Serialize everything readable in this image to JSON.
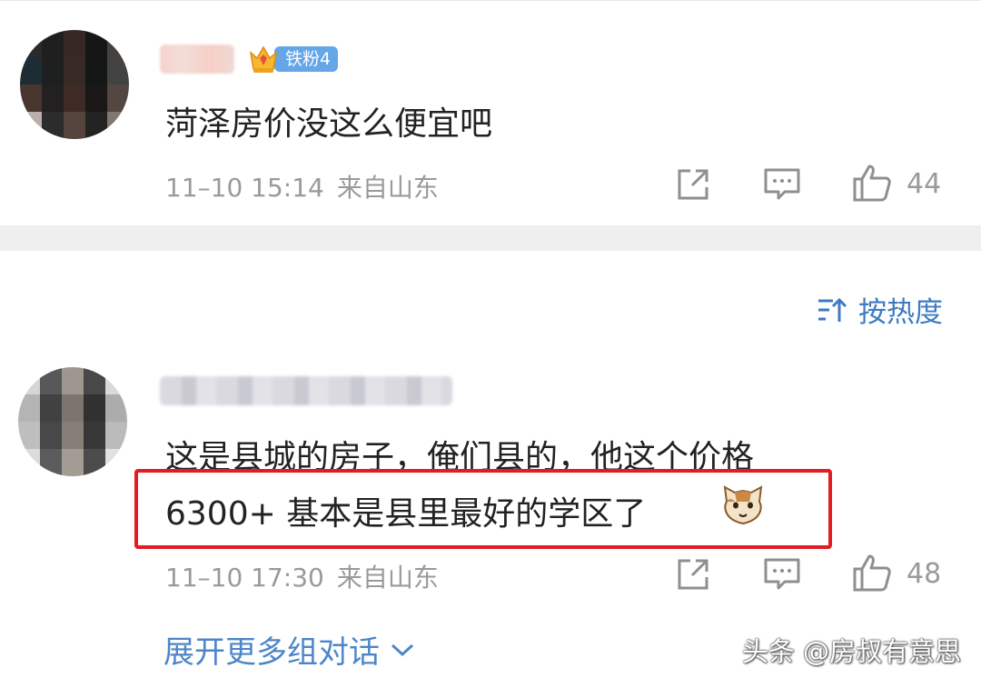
{
  "comment1": {
    "badge": "铁粉4",
    "text": "菏泽房价没这么便宜吧",
    "time": "11–10 15:14",
    "location": "来自山东",
    "like_count": "44",
    "icons": [
      "share-icon",
      "reply-icon",
      "like-icon",
      "crown-icon"
    ]
  },
  "sort": {
    "label": "按热度",
    "icon": "sort-icon"
  },
  "comment2": {
    "text_line1": "这是县城的房子，俺们县的，他这个价格",
    "text_line2": "6300+ 基本是县里最好的学区了",
    "emoji": "cat-emoji-icon",
    "time": "11–10 17:30",
    "location": "来自山东",
    "like_count": "48"
  },
  "more": {
    "label": "展开更多组对话",
    "icon": "chevron-down-icon"
  },
  "watermark": "头条 @房叔有意思",
  "colors": {
    "link": "#4d86c8",
    "meta": "#9a9a9a",
    "highlight": "#e31c24",
    "badge": "#64a6e8"
  }
}
